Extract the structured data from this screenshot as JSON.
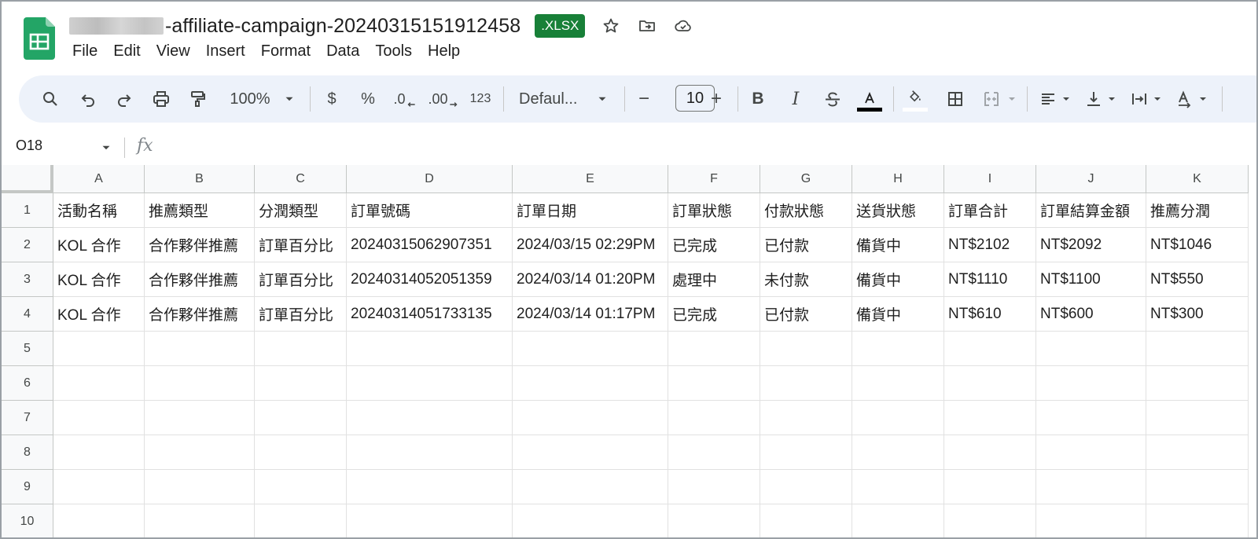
{
  "header": {
    "title_suffix": "-affiliate-campaign-20240315151912458",
    "badge": ".XLSX",
    "menu": [
      "File",
      "Edit",
      "View",
      "Insert",
      "Format",
      "Data",
      "Tools",
      "Help"
    ]
  },
  "toolbar": {
    "zoom": "100%",
    "currency": "$",
    "percent": "%",
    "decrease_decimal": ".0",
    "increase_decimal": ".00",
    "number_format": "123",
    "font": "Defaul...",
    "minus": "−",
    "font_size": "10",
    "plus": "+",
    "bold": "B",
    "italic": "I"
  },
  "formula_bar": {
    "cell_ref": "O18",
    "fx": "fx"
  },
  "grid": {
    "columns": [
      "A",
      "B",
      "C",
      "D",
      "E",
      "F",
      "G",
      "H",
      "I",
      "J",
      "K"
    ],
    "row_numbers": [
      "1",
      "2",
      "3",
      "4",
      "5",
      "6",
      "7",
      "8",
      "9",
      "10"
    ],
    "rows": [
      [
        "活動名稱",
        "推薦類型",
        "分潤類型",
        "訂單號碼",
        "訂單日期",
        "訂單狀態",
        "付款狀態",
        "送貨狀態",
        "訂單合計",
        "訂單結算金額",
        "推薦分潤"
      ],
      [
        "KOL 合作",
        "合作夥伴推薦",
        "訂單百分比",
        "20240315062907351",
        "2024/03/15 02:29PM",
        "已完成",
        "已付款",
        "備貨中",
        "NT$2102",
        "NT$2092",
        "NT$1046"
      ],
      [
        "KOL 合作",
        "合作夥伴推薦",
        "訂單百分比",
        "20240314052051359",
        "2024/03/14 01:20PM",
        "處理中",
        "未付款",
        "備貨中",
        "NT$1110",
        "NT$1100",
        "NT$550"
      ],
      [
        "KOL 合作",
        "合作夥伴推薦",
        "訂單百分比",
        "20240314051733135",
        "2024/03/14 01:17PM",
        "已完成",
        "已付款",
        "備貨中",
        "NT$610",
        "NT$600",
        "NT$300"
      ]
    ]
  },
  "colors": {
    "sheets_green": "#188038",
    "toolbar_bg": "#edf2fa",
    "header_bg": "#f8f9fa",
    "grid_line": "#e1e1e1"
  }
}
